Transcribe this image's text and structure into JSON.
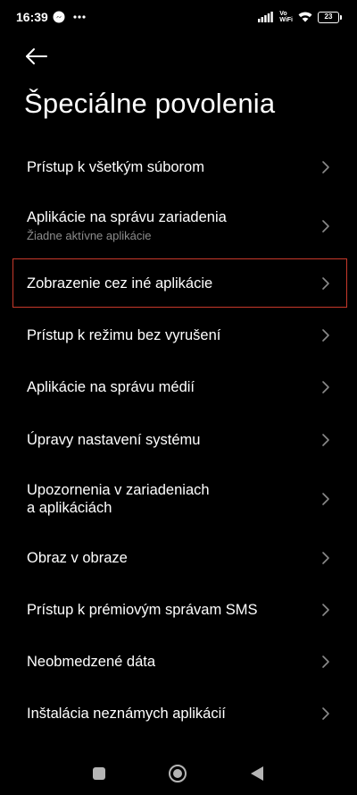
{
  "status_bar": {
    "time": "16:39",
    "network_label_line1": "Vo",
    "network_label_line2": "WiFi",
    "battery_level": "23",
    "left_icons": [
      "messenger-icon",
      "more-dots-icon"
    ],
    "right_icons": [
      "signal-icon",
      "vowifi-icon",
      "wifi-icon",
      "battery-icon"
    ]
  },
  "header": {
    "back_icon": "arrow-left-icon",
    "title": "Špeciálne povolenia"
  },
  "items": [
    {
      "title": "Prístup k všetkým súborom"
    },
    {
      "title": "Aplikácie na správu zariadenia",
      "subtitle": "Žiadne aktívne aplikácie"
    },
    {
      "title": "Zobrazenie cez iné aplikácie",
      "highlighted": true
    },
    {
      "title": "Prístup k režimu bez vyrušení"
    },
    {
      "title": "Aplikácie na správu médií"
    },
    {
      "title": "Úpravy nastavení systému"
    },
    {
      "title": "Upozornenia v zariadeniach",
      "title_line2": "a aplikáciách"
    },
    {
      "title": "Obraz v obraze"
    },
    {
      "title": "Prístup k prémiovým správam SMS"
    },
    {
      "title": "Neobmedzené dáta"
    },
    {
      "title": "Inštalácia neznámych aplikácií"
    }
  ],
  "nav_bar": {
    "buttons": [
      "recents-square-icon",
      "home-circle-icon",
      "back-triangle-icon"
    ]
  },
  "colors": {
    "background": "#000000",
    "text": "#ffffff",
    "subtitle": "#8c8c8c",
    "chevron": "#8a8a8a",
    "highlight_border": "#c8392b"
  }
}
